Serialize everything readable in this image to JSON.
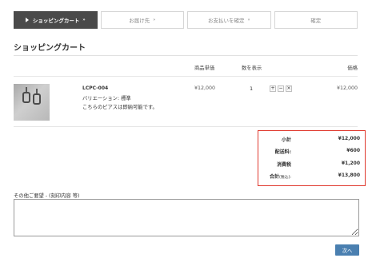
{
  "steps": [
    {
      "label": "ショッピングカート",
      "chev": "»"
    },
    {
      "label": "お届け先",
      "chev": "»"
    },
    {
      "label": "お支払いを確定",
      "chev": "»"
    },
    {
      "label": "確定",
      "chev": ""
    }
  ],
  "page_title": "ショッピングカート",
  "table": {
    "headers": {
      "unit_price": "商品単価",
      "qty": "数を表示",
      "price": "価格"
    }
  },
  "item": {
    "code": "LCPC-004",
    "variation": "バリエーション: 標準",
    "note": "こちらのピアスは即納可能です。",
    "unit_price": "¥12,000",
    "qty": "1",
    "qty_buttons": [
      "+",
      "−",
      "×"
    ],
    "price": "¥12,000"
  },
  "summary": {
    "subtotal_label": "小計",
    "subtotal_value": "¥12,000",
    "shipping_label": "配送料:",
    "shipping_value": "¥600",
    "tax_label": "消費税",
    "tax_value": "¥1,200",
    "total_label": "合計",
    "total_note": "(税込):",
    "total_value": "¥13,800"
  },
  "notes": {
    "label": "その他ご要望 - (刻印内容 等)",
    "value": ""
  },
  "next_button": "次へ",
  "colors": {
    "active_step": "#4a4a4a",
    "summary_border": "#e03a2f",
    "next_button": "#4a7fb0"
  }
}
